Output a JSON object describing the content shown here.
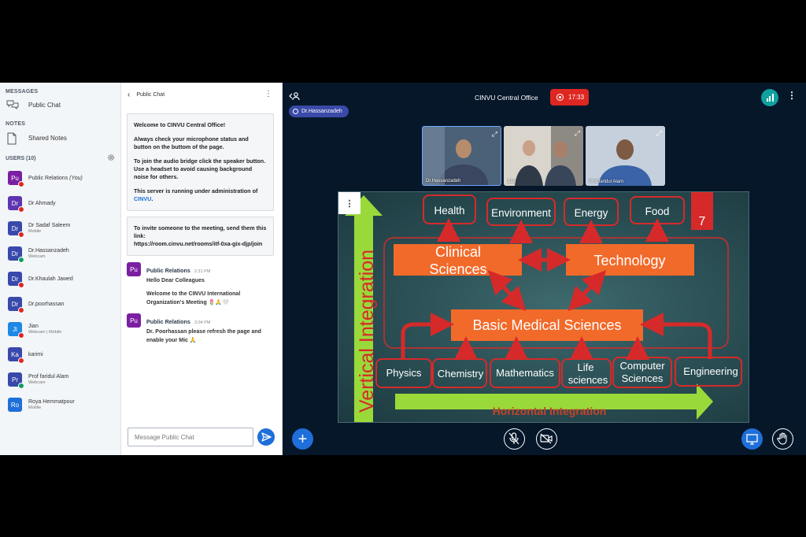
{
  "sidebar": {
    "messages_title": "MESSAGES",
    "public_chat_label": "Public Chat",
    "notes_title": "NOTES",
    "shared_notes_label": "Shared Notes",
    "users_title": "USERS (10)",
    "users": [
      {
        "initials": "Pu",
        "name": "Public Relations",
        "you": "(You)",
        "sub": "",
        "color": "#7b1fa2",
        "mic": "off"
      },
      {
        "initials": "Dr",
        "name": "Dr Ahmady",
        "sub": "",
        "color": "#5e35b1",
        "mic": "off"
      },
      {
        "initials": "Dr",
        "name": "Dr Sadaf Saleem",
        "sub": "Mobile",
        "color": "#3949ab",
        "mic": "off"
      },
      {
        "initials": "Dr",
        "name": "Dr.Hassanzadeh",
        "sub": "Webcam",
        "color": "#3949ab",
        "mic": "on"
      },
      {
        "initials": "Dr",
        "name": "Dr.Khaulah Jawed",
        "sub": "",
        "color": "#3949ab",
        "mic": "off"
      },
      {
        "initials": "Dr",
        "name": "Dr.poorhassan",
        "sub": "",
        "color": "#3949ab",
        "mic": "off"
      },
      {
        "initials": "Ji",
        "name": "Jian",
        "sub": "Webcam | Mobile",
        "color": "#1e88e5",
        "mic": "off"
      },
      {
        "initials": "Ka",
        "name": "karimi",
        "sub": "",
        "color": "#3949ab",
        "mic": "off"
      },
      {
        "initials": "Pr",
        "name": "Prof faridul Alam",
        "sub": "Webcam",
        "color": "#3949ab",
        "mic": "on"
      },
      {
        "initials": "Ro",
        "name": "Roya Hemmatpour",
        "sub": "Mobile",
        "color": "#1e6fd9",
        "mic": "none"
      }
    ]
  },
  "chat": {
    "title": "Public Chat",
    "welcome_title": "Welcome to CINVU Central Office!",
    "welcome_p1": "Always check your microphone status and button on the buttom of the page.",
    "welcome_p2": "To join the audio bridge click the speaker button. Use a headset to avoid causing background noise for others.",
    "welcome_p3_prefix": "This server is running under administration of ",
    "welcome_p3_link": "CINVU",
    "welcome_p3_suffix": ".",
    "invite_text": "To invite someone to the meeting, send them this link:",
    "invite_link": "https://room.cinvu.net/rooms/itf-0xa-gix-djp/join",
    "messages": [
      {
        "initials": "Pu",
        "sender": "Public Relations",
        "time": "2:31 PM",
        "lines": [
          "Hello Dear Colleagues",
          "Welcome to the CINVU International Organization's Meeting 🌷🙏🤍"
        ]
      },
      {
        "initials": "Pu",
        "sender": "Public Relations",
        "time": "3:04 PM",
        "lines": [
          "Dr. Poorhassan please refresh the page and enable your Mic 🙏"
        ]
      }
    ],
    "input_placeholder": "Message Public Chat"
  },
  "main": {
    "meeting_title": "CINVU Central Office",
    "record_time": "17:33",
    "presenter": "Dr.Hassanzadeh",
    "webcams": [
      {
        "name": "Dr.Hassanzadeh"
      },
      {
        "name": "Jian"
      },
      {
        "name": "Prof faridul Alam"
      }
    ]
  },
  "slide": {
    "page_number": "7",
    "vertical_label": "Vertical Integration",
    "horizontal_label": "Horizontal Integration",
    "top_boxes": [
      "Health",
      "Environment",
      "Energy",
      "Food"
    ],
    "clinical": [
      "Clinical",
      "Sciences"
    ],
    "technology": "Technology",
    "basic": "Basic Medical Sciences",
    "bottom_boxes": [
      {
        "lines": [
          "Physics"
        ]
      },
      {
        "lines": [
          "Chemistry"
        ]
      },
      {
        "lines": [
          "Mathematics"
        ]
      },
      {
        "lines": [
          "Life",
          "sciences"
        ]
      },
      {
        "lines": [
          "Computer",
          "Sciences"
        ]
      },
      {
        "lines": [
          "Engineering"
        ]
      }
    ]
  },
  "colors": {
    "accent": "#1e6fd9",
    "record": "#df2721",
    "slide_orange": "#f26a2a",
    "slide_green": "#9ad93a",
    "slide_red": "#d62a2a"
  }
}
